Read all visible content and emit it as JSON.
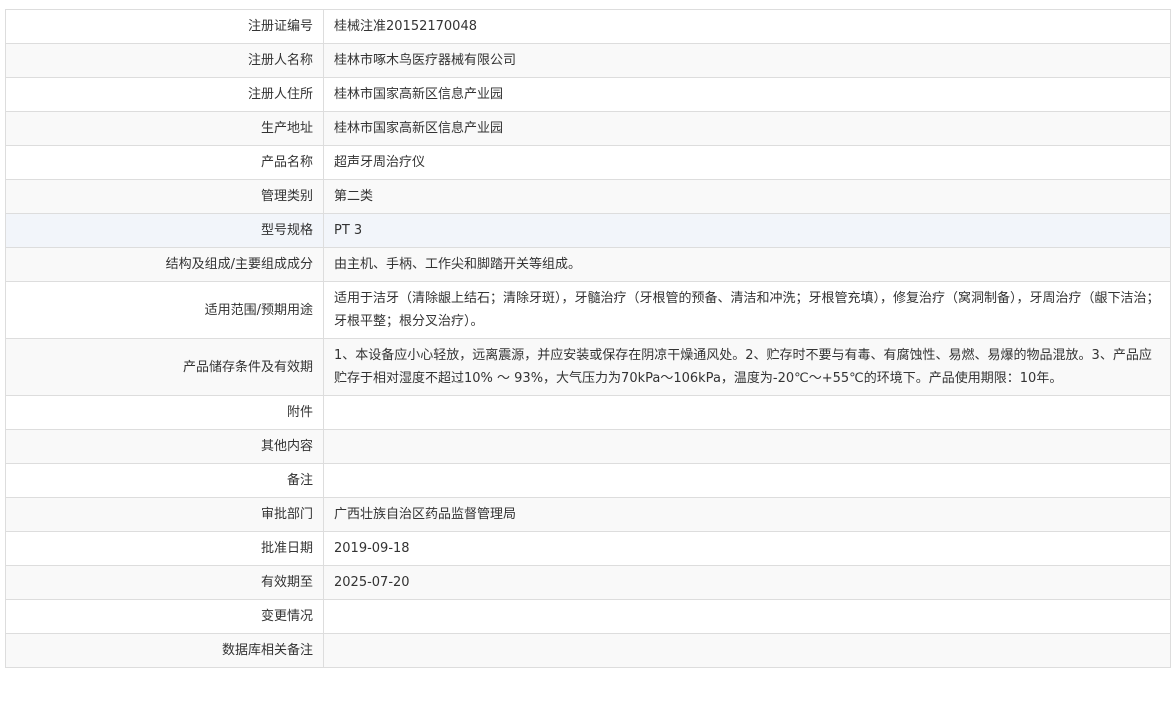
{
  "rows": [
    {
      "label": "注册证编号",
      "value": "桂械注准20152170048"
    },
    {
      "label": "注册人名称",
      "value": "桂林市啄木鸟医疗器械有限公司"
    },
    {
      "label": "注册人住所",
      "value": "桂林市国家高新区信息产业园"
    },
    {
      "label": "生产地址",
      "value": "桂林市国家高新区信息产业园"
    },
    {
      "label": "产品名称",
      "value": "超声牙周治疗仪"
    },
    {
      "label": "管理类别",
      "value": "第二类"
    },
    {
      "label": "型号规格",
      "value": "PT 3"
    },
    {
      "label": "结构及组成/主要组成成分",
      "value": "由主机、手柄、工作尖和脚踏开关等组成。"
    },
    {
      "label": "适用范围/预期用途",
      "value": "适用于洁牙（清除龈上结石；清除牙斑），牙髓治疗（牙根管的预备、清洁和冲洗；牙根管充填），修复治疗（窝洞制备），牙周治疗（龈下洁治；牙根平整；根分叉治疗）。"
    },
    {
      "label": "产品储存条件及有效期",
      "value": "1、本设备应小心轻放，远离震源，并应安装或保存在阴凉干燥通风处。2、贮存时不要与有毒、有腐蚀性、易燃、易爆的物品混放。3、产品应贮存于相对湿度不超过10% ～ 93%，大气压力为70kPa～106kPa，温度为-20℃～+55℃的环境下。产品使用期限：10年。"
    },
    {
      "label": "附件",
      "value": ""
    },
    {
      "label": "其他内容",
      "value": ""
    },
    {
      "label": "备注",
      "value": ""
    },
    {
      "label": "审批部门",
      "value": "广西壮族自治区药品监督管理局"
    },
    {
      "label": "批准日期",
      "value": "2019-09-18"
    },
    {
      "label": "有效期至",
      "value": "2025-07-20"
    },
    {
      "label": "变更情况",
      "value": ""
    },
    {
      "label": "数据库相关备注",
      "value": ""
    }
  ]
}
